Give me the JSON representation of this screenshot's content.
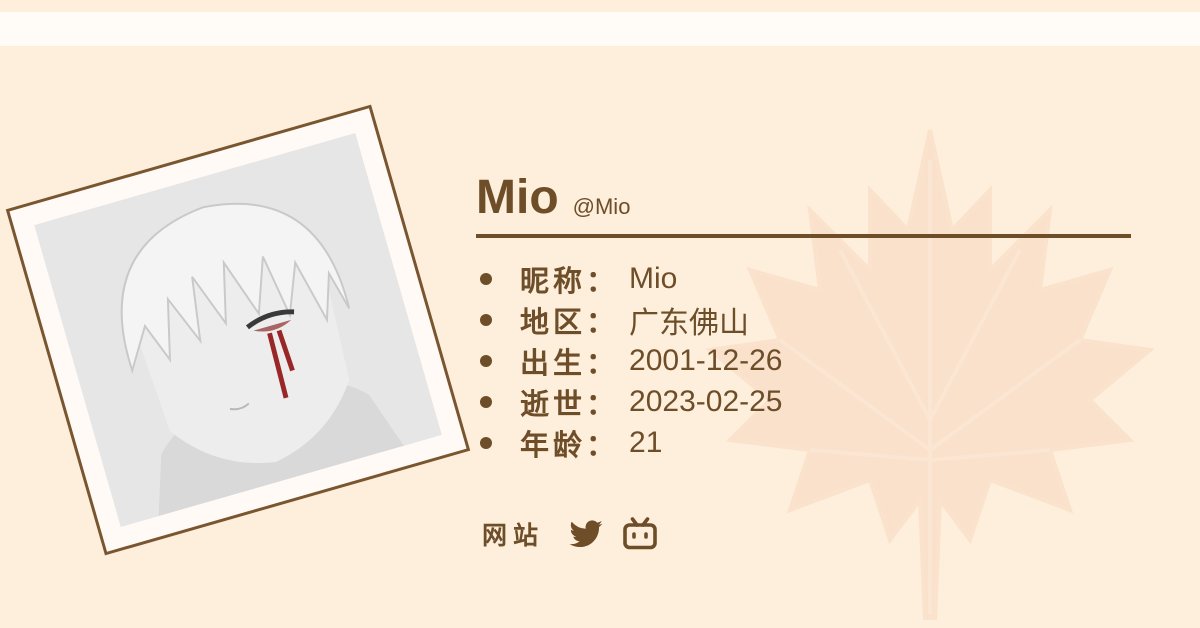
{
  "profile": {
    "name": "Mio",
    "handle": "@Mio"
  },
  "info": [
    {
      "label": "昵称",
      "value": "Mio"
    },
    {
      "label": "地区",
      "value": "广东佛山"
    },
    {
      "label": "出生",
      "value": "2001-12-26"
    },
    {
      "label": "逝世",
      "value": "2023-02-25"
    },
    {
      "label": "年龄",
      "value": "21"
    }
  ],
  "links": {
    "label": "网站",
    "icons": [
      "twitter-icon",
      "bilibili-icon"
    ]
  },
  "colors": {
    "background": "#fdefdc",
    "accent": "#6e4d29",
    "band": "#fffbf6",
    "leaf": "#f6d6be"
  },
  "info_separator": "："
}
